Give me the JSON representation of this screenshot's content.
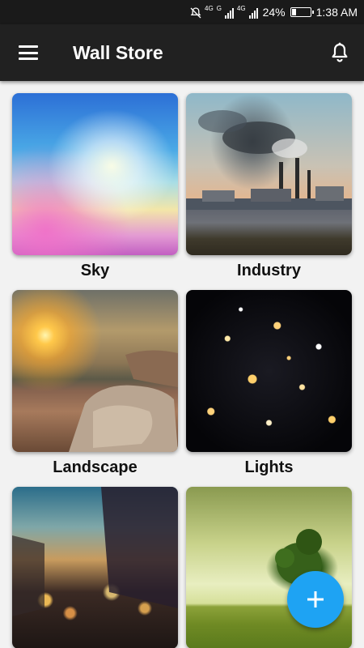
{
  "status_bar": {
    "network_labels": [
      "4G",
      "G",
      "4G"
    ],
    "battery": "24%",
    "battery_level": 0.24,
    "time": "1:38 AM"
  },
  "app_bar": {
    "title": "Wall Store",
    "menu_icon": "hamburger-menu-icon",
    "notification_icon": "bell-icon"
  },
  "categories": [
    {
      "label": "Sky"
    },
    {
      "label": "Industry"
    },
    {
      "label": "Landscape"
    },
    {
      "label": "Lights"
    },
    {
      "label": ""
    },
    {
      "label": ""
    }
  ],
  "fab": {
    "icon": "plus-icon",
    "color": "#1ea3f3"
  }
}
